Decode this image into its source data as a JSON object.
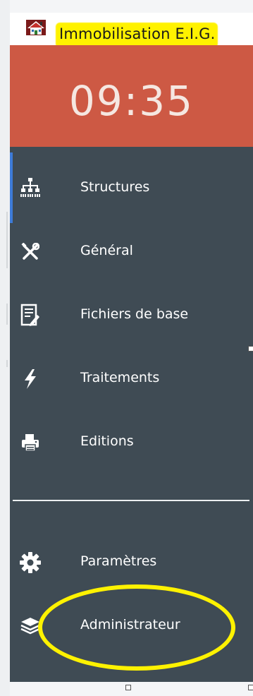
{
  "app": {
    "title": "Immobilisation E.I.G.",
    "icon": "house-app-icon"
  },
  "clock": {
    "time": "09:35",
    "color": "#cd5944"
  },
  "nav": {
    "background": "#3f4b54",
    "items": [
      {
        "label": "Structures",
        "icon": "org-chart-icon",
        "active": true
      },
      {
        "label": "Général",
        "icon": "tools-icon"
      },
      {
        "label": "Fichiers de base",
        "icon": "document-edit-icon"
      },
      {
        "label": "Traitements",
        "icon": "lightning-icon"
      },
      {
        "label": "Editions",
        "icon": "printer-icon"
      }
    ],
    "bottom_items": [
      {
        "label": "Paramètres",
        "icon": "gear-icon"
      },
      {
        "label": "Administrateur",
        "icon": "layers-icon"
      }
    ]
  },
  "annotations": {
    "highlight_color": "#fff200"
  }
}
